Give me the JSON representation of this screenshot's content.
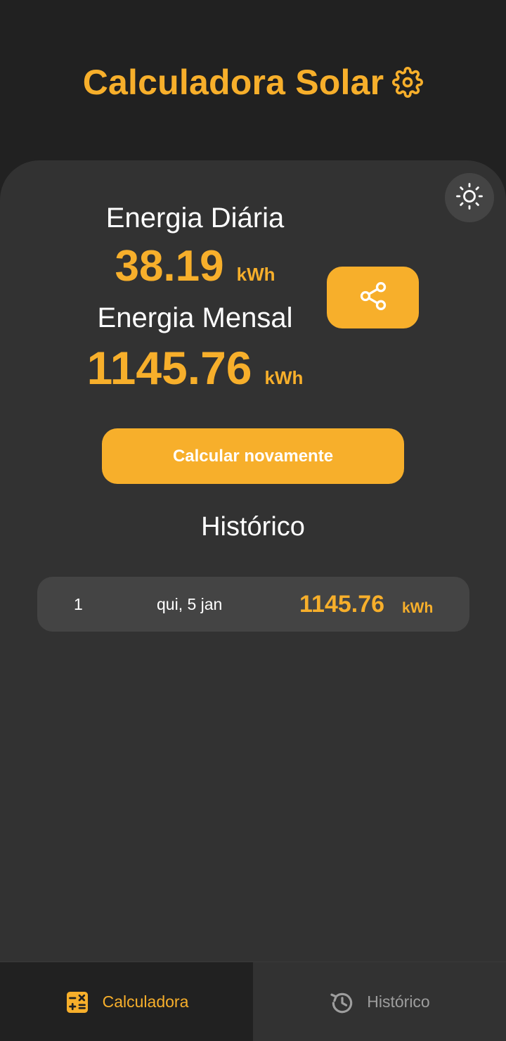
{
  "header": {
    "title": "Calculadora Solar",
    "title_icon": "gear-icon"
  },
  "results": {
    "daily_label": "Energia Diária",
    "daily_value": "38.19",
    "daily_unit": "kWh",
    "monthly_label": "Energia Mensal",
    "monthly_value": "1145.76",
    "monthly_unit": "kWh"
  },
  "actions": {
    "share_icon": "share-icon",
    "theme_icon": "sun-icon",
    "recalculate_label": "Calcular novamente"
  },
  "history": {
    "title": "Histórico",
    "rows": [
      {
        "index": "1",
        "date": "qui, 5 jan",
        "value": "1145.76",
        "unit": "kWh"
      }
    ]
  },
  "bottom_nav": {
    "items": [
      {
        "label": "Calculadora",
        "icon": "calculator-icon",
        "active": true
      },
      {
        "label": "Histórico",
        "icon": "history-icon",
        "active": false
      }
    ]
  },
  "colors": {
    "accent": "#F7AF2B",
    "background": "#212121",
    "card": "#323232",
    "row": "#444444"
  }
}
